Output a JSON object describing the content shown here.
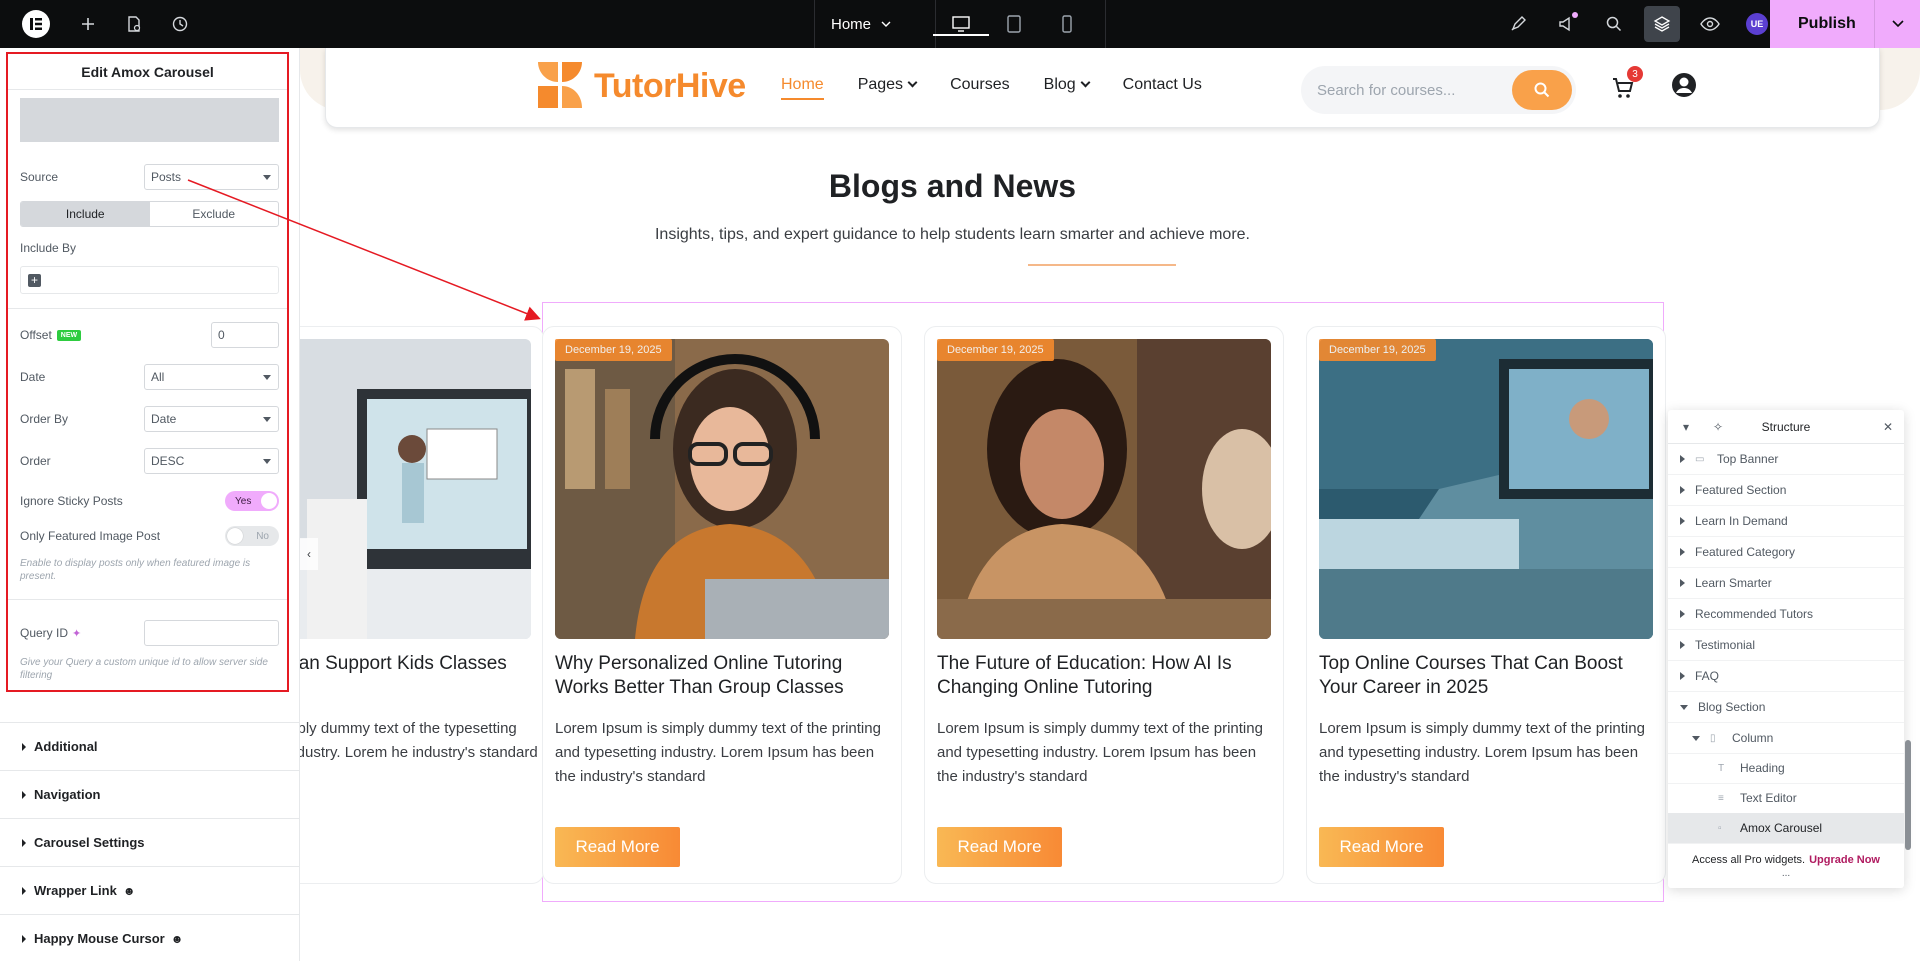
{
  "topbar": {
    "page_label": "Home",
    "publish_label": "Publish",
    "avatar_initials": "UE"
  },
  "panel": {
    "title": "Edit Amox Carousel",
    "source_label": "Source",
    "source_value": "Posts",
    "include_label": "Include",
    "exclude_label": "Exclude",
    "include_by_label": "Include By",
    "offset_label": "Offset",
    "offset_badge": "NEW",
    "offset_value": "0",
    "date_label": "Date",
    "date_value": "All",
    "order_by_label": "Order By",
    "order_by_value": "Date",
    "order_label": "Order",
    "order_value": "DESC",
    "sticky_label": "Ignore Sticky Posts",
    "sticky_value": "Yes",
    "featured_label": "Only Featured Image Post",
    "featured_value": "No",
    "featured_help": "Enable to display posts only when featured image is present.",
    "query_label": "Query ID",
    "query_help": "Give your Query a custom unique id to allow server side filtering",
    "sections": [
      "Additional",
      "Navigation",
      "Carousel Settings",
      "Wrapper Link",
      "Happy Mouse Cursor"
    ]
  },
  "site": {
    "logo_text": "TutorHive",
    "nav": [
      "Home",
      "Pages",
      "Courses",
      "Blog",
      "Contact Us"
    ],
    "search_placeholder": "Search for courses...",
    "cart_count": "3"
  },
  "blog": {
    "title": "Blogs and News",
    "subtitle": "Insights, tips, and expert guidance to help students learn smarter and achieve more.",
    "cards": [
      {
        "title": "Can Support Kids Classes",
        "text": "mply dummy text of the typesetting industry. Lorem he industry's standard"
      },
      {
        "date": "December 19, 2025",
        "title": "Why Personalized Online Tutoring Works Better Than Group Classes",
        "text": "Lorem Ipsum is simply dummy text of the printing and typesetting industry. Lorem Ipsum has been the industry's standard",
        "button": "Read More"
      },
      {
        "date": "December 19, 2025",
        "title": "The Future of Education: How AI Is Changing Online Tutoring",
        "text": "Lorem Ipsum is simply dummy text of the printing and typesetting industry. Lorem Ipsum has been the industry's standard",
        "button": "Read More"
      },
      {
        "date": "December 19, 2025",
        "title": "Top Online Courses That Can Boost Your Career in 2025",
        "text": "Lorem Ipsum is simply dummy text of the printing and typesetting industry. Lorem Ipsum has been the industry's standard",
        "button": "Read More"
      }
    ]
  },
  "structure": {
    "title": "Structure",
    "items": [
      "Top Banner",
      "Featured Section",
      "Learn In Demand",
      "Featured Category",
      "Learn Smarter",
      "Recommended Tutors",
      "Testimonial",
      "FAQ",
      "Blog Section",
      "Column",
      "Heading",
      "Text Editor",
      "Amox Carousel"
    ],
    "footer_text": "Access all Pro widgets.",
    "footer_link": "Upgrade Now",
    "more": "..."
  },
  "colors": {
    "accent": "#f58a2d",
    "editor_pink": "#f0abfc",
    "annotation_red": "#e51a23"
  }
}
